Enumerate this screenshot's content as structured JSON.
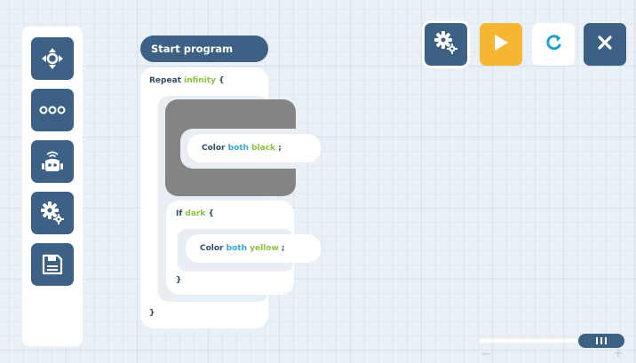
{
  "toolbar": {
    "settings_icon": "gears-icon",
    "play_icon": "play-icon",
    "reload_icon": "reload-icon",
    "close_icon": "close-icon",
    "colors": {
      "dark_blue": "#3c6184",
      "orange": "#f5b731",
      "teal": "#1e9fd6"
    }
  },
  "sidebar": {
    "items": [
      {
        "icon": "move-icon"
      },
      {
        "icon": "more-icon"
      },
      {
        "icon": "robot-icon"
      },
      {
        "icon": "gears-icon"
      },
      {
        "icon": "save-icon"
      }
    ]
  },
  "program": {
    "start": "Start program",
    "repeat": {
      "keyword": "Repeat",
      "param": "infinity",
      "open": "{",
      "close": "}"
    },
    "color1": {
      "keyword": "Color",
      "target": "both",
      "value": "black",
      "end": ";"
    },
    "if_block": {
      "keyword": "If",
      "param": "dark",
      "open": "{",
      "close": "}"
    },
    "color2": {
      "keyword": "Color",
      "target": "both",
      "value": "yellow",
      "end": ";"
    }
  },
  "zoom": {
    "minus": "−",
    "plus": "+",
    "level": 0.9
  }
}
